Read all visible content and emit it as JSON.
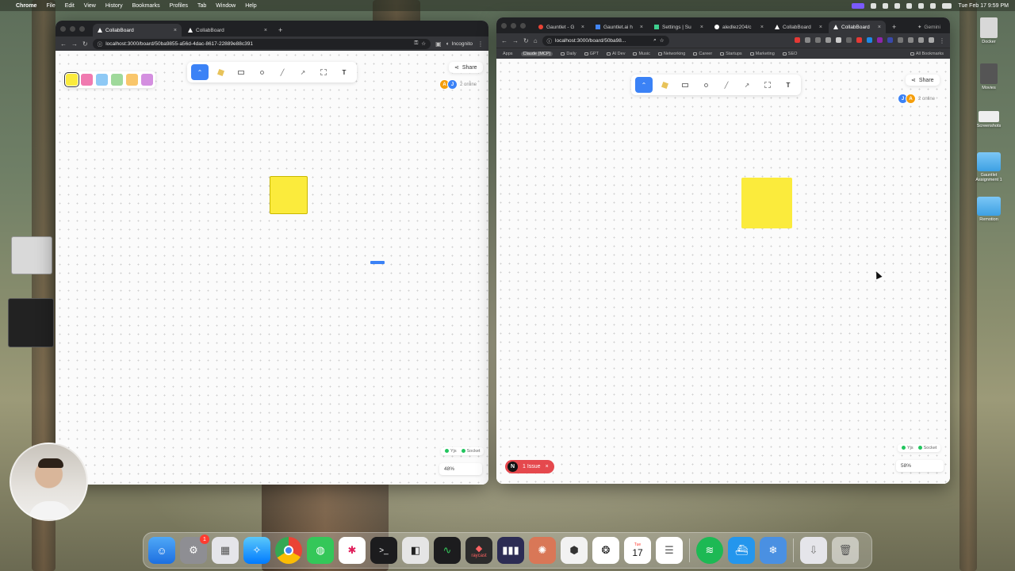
{
  "menubar": {
    "app_name": "Chrome",
    "items": [
      "File",
      "Edit",
      "View",
      "History",
      "Bookmarks",
      "Profiles",
      "Tab",
      "Window",
      "Help"
    ],
    "clock": "Tue Feb 17  9:59 PM"
  },
  "left_window": {
    "tabs": [
      {
        "label": "CollabBoard",
        "active": true
      },
      {
        "label": "CollabBoard",
        "active": false
      }
    ],
    "url": "localhost:3000/board/50ba9855-a56d-4dac-8617-22889e88c391",
    "incognito_label": "Incognito",
    "palette": {
      "colors": [
        "#fbeb3c",
        "#f07ab0",
        "#8ec9f5",
        "#9fd99b",
        "#f9c66b",
        "#d48fe0"
      ],
      "selected": 0
    },
    "share_label": "Share",
    "avatars": [
      {
        "initial": "A",
        "color": "#f59e0b"
      },
      {
        "initial": "J",
        "color": "#3b82f6"
      }
    ],
    "online_label": "2 online",
    "status": {
      "yjs": "Yjs",
      "socket": "Socket"
    },
    "zoom": "48%"
  },
  "right_window": {
    "tabs": [
      {
        "label": "Gauntlet - G",
        "active": false
      },
      {
        "label": "Gauntlet.ai h",
        "active": false
      },
      {
        "label": "Settings | Su",
        "active": false
      },
      {
        "label": "aledlez204/c",
        "active": false
      },
      {
        "label": "CollabBoard",
        "active": false
      },
      {
        "label": "CollabBoard",
        "active": true
      }
    ],
    "gemini_label": "Gemini",
    "url": "localhost:3000/board/50ba98...",
    "bookmarks": [
      "Apps",
      "Claude (MCP)",
      "Daily",
      "GPT",
      "AI Dev",
      "Music",
      "Networking",
      "Career",
      "Startups",
      "Marketing",
      "SEO",
      "All Bookmarks"
    ],
    "share_label": "Share",
    "avatars": [
      {
        "initial": "J",
        "color": "#3b82f6"
      },
      {
        "initial": "A",
        "color": "#f59e0b"
      }
    ],
    "online_label": "2 online",
    "status": {
      "yjs": "Yjs",
      "socket": "Socket"
    },
    "zoom": "58%",
    "issue": {
      "badge": "N",
      "label": "1 Issue"
    }
  },
  "tools": [
    "select",
    "sticky",
    "rectangle",
    "circle",
    "line",
    "arrow",
    "frame",
    "text"
  ],
  "tool_text_label": "T",
  "desktop_icons": [
    {
      "label": "Docker"
    },
    {
      "label": "Movies"
    },
    {
      "label": "Screenshots"
    },
    {
      "label": "Gauntlet Assignment 1"
    },
    {
      "label": "Remotion"
    }
  ],
  "dock": {
    "apps": [
      "Finder",
      "System Settings",
      "Launchpad",
      "Safari",
      "Chrome",
      "Messages",
      "Slack",
      "Terminal",
      "Cursor",
      "Activity Monitor",
      "Raycast",
      "Analytics",
      "Claude",
      "Cube",
      "ChatGPT",
      "Calendar",
      "Reminders",
      "Spotify",
      "Docker",
      "Tailscale"
    ],
    "settings_badge": "1",
    "calendar_day": "17",
    "calendar_month": "Tue",
    "raycast_label": "raycast"
  }
}
